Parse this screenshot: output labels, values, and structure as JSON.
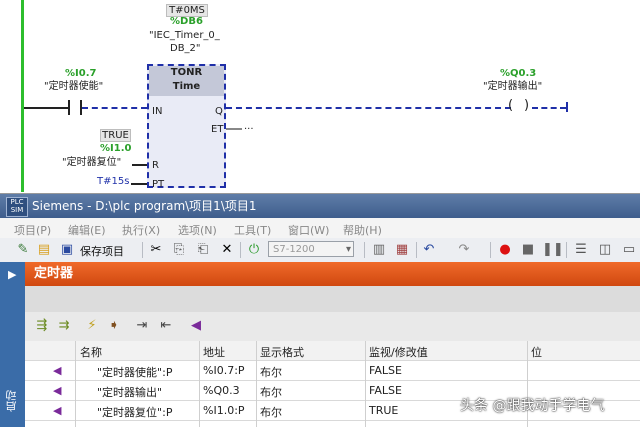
{
  "ladder": {
    "timer_label": "T#0MS",
    "db_tag": "%DB6",
    "instance_name_line1": "\"IEC_Timer_0_",
    "instance_name_line2": "DB_2\"",
    "block_type": "TONR",
    "block_subtype": "Time",
    "pin_in": "IN",
    "pin_q": "Q",
    "pin_et": "ET",
    "pin_r": "R",
    "pin_pt": "PT",
    "et_value": "...",
    "in_address": "%I0.7",
    "in_name": "\"定时器使能\"",
    "out_address": "%Q0.3",
    "out_name": "\"定时器输出\"",
    "reset_value": "TRUE",
    "reset_address": "%I1.0",
    "reset_name": "\"定时器复位\"",
    "pt_value": "T#15s"
  },
  "window": {
    "title": "Siemens  -  D:\\plc program\\项目1\\项目1",
    "logo_text": "PLC SIM",
    "menu": [
      "项目(P)",
      "编辑(E)",
      "执行(X)",
      "选项(N)",
      "工具(T)",
      "窗口(W)",
      "帮助(H)"
    ],
    "toolbar_save_label": "保存项目",
    "cpu_select": "S7-1200",
    "nav_label": "启动",
    "table_title": "定时器",
    "columns": [
      "名称",
      "地址",
      "显示格式",
      "监视/修改值",
      "位"
    ],
    "rows": [
      {
        "name": "\"定时器使能\":P",
        "address": "%I0.7:P",
        "format": "布尔",
        "value": "FALSE"
      },
      {
        "name": "\"定时器输出\"",
        "address": "%Q0.3",
        "format": "布尔",
        "value": "FALSE"
      },
      {
        "name": "\"定时器复位\":P",
        "address": "%I1.0:P",
        "format": "布尔",
        "value": "TRUE"
      }
    ]
  },
  "watermark": "头条 @跟我动手学电气",
  "colors": {
    "rail": "#2dbe2d",
    "block_border": "#1f2fa8",
    "table_header": "#e05a1c",
    "title_bar": "#4a6a98"
  }
}
